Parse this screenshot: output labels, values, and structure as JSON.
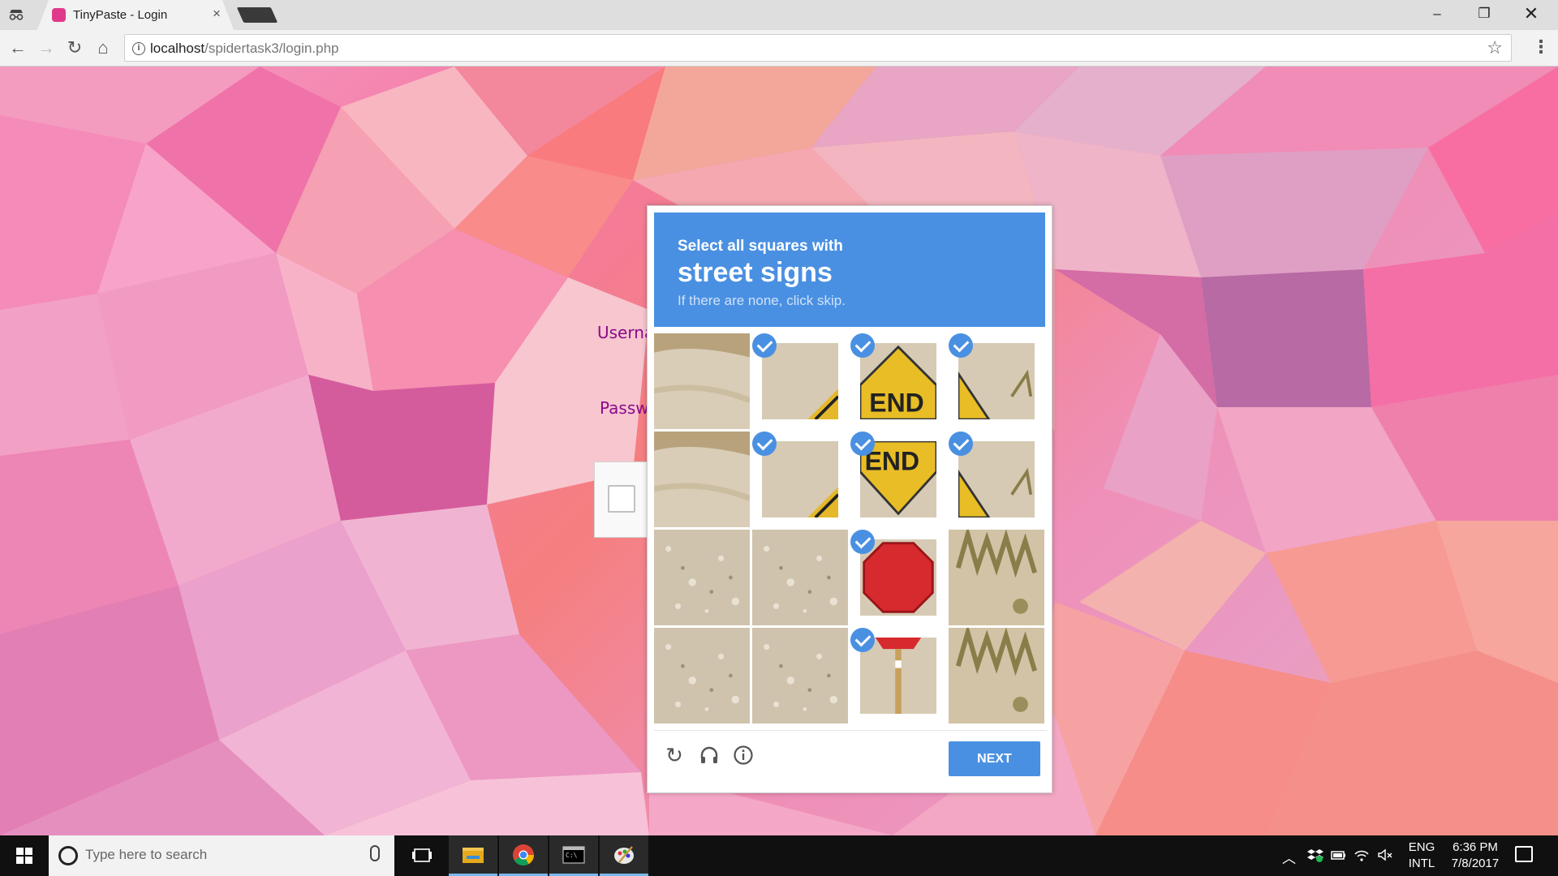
{
  "browser": {
    "tab_title": "TinyPaste - Login",
    "tab_close": "×",
    "url_host": "localhost",
    "url_path": "/spidertask3/login.php",
    "icons": [
      "incognito-icon",
      "back-icon",
      "forward-icon",
      "reload-icon",
      "home-icon",
      "info-icon",
      "star-icon",
      "menu-icon"
    ]
  },
  "window_controls": {
    "minimize": "–",
    "maximize": "❐",
    "close": "✕"
  },
  "login": {
    "username_label": "Userna",
    "password_label": "Passw"
  },
  "captcha": {
    "instruction": "Select all squares with",
    "target": "street signs",
    "hint": "If there are none, click skip.",
    "next_label": "NEXT",
    "accent": "#4a90e2",
    "tiles": [
      {
        "row": 0,
        "col": 0,
        "selected": false,
        "content": "sand"
      },
      {
        "row": 0,
        "col": 1,
        "selected": true,
        "content": "sign-edge"
      },
      {
        "row": 0,
        "col": 2,
        "selected": true,
        "content": "yellow-sign-top"
      },
      {
        "row": 0,
        "col": 3,
        "selected": true,
        "content": "yellow-sign-corner"
      },
      {
        "row": 1,
        "col": 0,
        "selected": false,
        "content": "sand"
      },
      {
        "row": 1,
        "col": 1,
        "selected": true,
        "content": "sign-edge"
      },
      {
        "row": 1,
        "col": 2,
        "selected": true,
        "content": "yellow-sign-mid"
      },
      {
        "row": 1,
        "col": 3,
        "selected": true,
        "content": "yellow-sign-corner"
      },
      {
        "row": 2,
        "col": 0,
        "selected": false,
        "content": "gravel"
      },
      {
        "row": 2,
        "col": 1,
        "selected": false,
        "content": "gravel"
      },
      {
        "row": 2,
        "col": 2,
        "selected": true,
        "content": "red-sign"
      },
      {
        "row": 2,
        "col": 3,
        "selected": false,
        "content": "brush"
      },
      {
        "row": 3,
        "col": 0,
        "selected": false,
        "content": "gravel"
      },
      {
        "row": 3,
        "col": 1,
        "selected": false,
        "content": "gravel"
      },
      {
        "row": 3,
        "col": 2,
        "selected": true,
        "content": "sign-pole"
      },
      {
        "row": 3,
        "col": 3,
        "selected": false,
        "content": "brush"
      }
    ]
  },
  "taskbar": {
    "search_placeholder": "Type here to search",
    "lang_line1": "ENG",
    "lang_line2": "INTL",
    "time": "6:36 PM",
    "date": "7/8/2017"
  }
}
